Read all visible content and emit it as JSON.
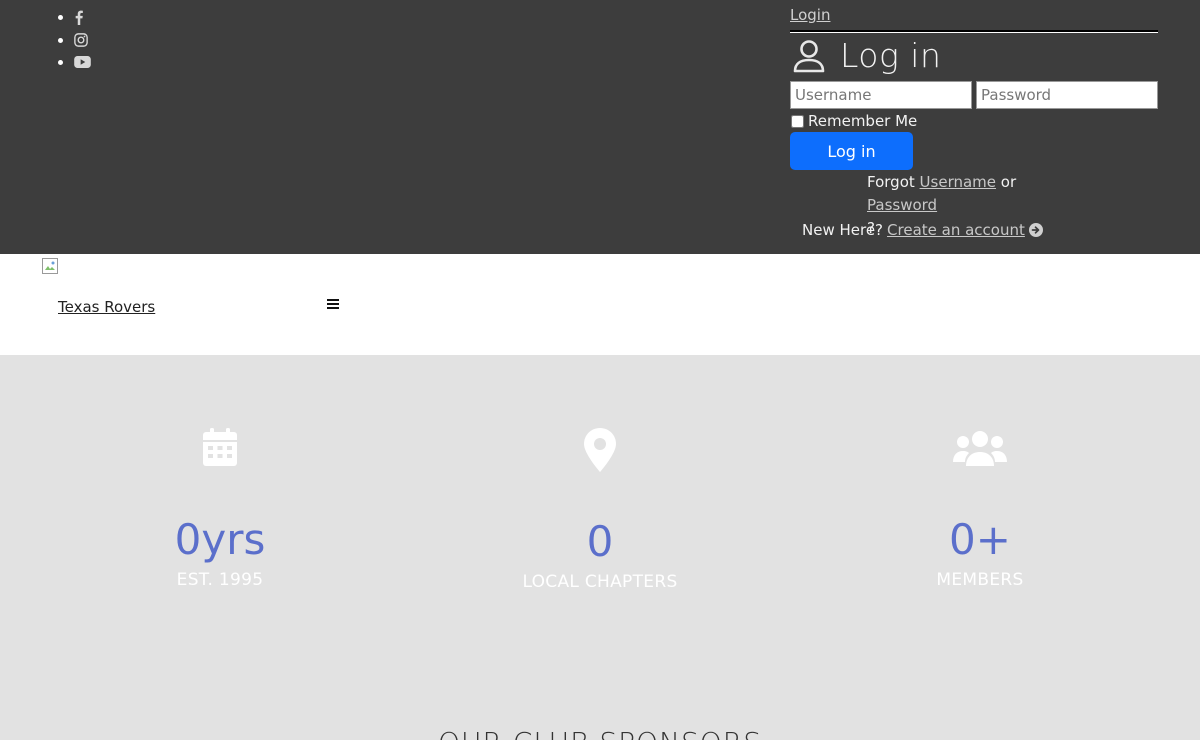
{
  "header": {
    "social": [
      {
        "icon": "facebook-icon"
      },
      {
        "icon": "instagram-icon"
      },
      {
        "icon": "youtube-icon"
      }
    ],
    "login_link": "Login",
    "login_title": "Log in",
    "username_placeholder": "Username",
    "password_placeholder": "Password",
    "remember_label": "Remember Me",
    "login_button": "Log in",
    "forgot_prefix": "Forgot",
    "forgot_username": "Username",
    "forgot_or": "or",
    "forgot_password": "Password",
    "forgot_suffix": "?",
    "new_here": "New Here?",
    "create_account": "Create an account"
  },
  "nav": {
    "brand": "Texas Rovers"
  },
  "stats": [
    {
      "icon": "calendar-icon",
      "value": "0yrs",
      "label": "EST. 1995"
    },
    {
      "icon": "map-pin-icon",
      "value": "0",
      "label": "LOCAL CHAPTERS"
    },
    {
      "icon": "users-icon",
      "value": "0+",
      "label": "MEMBERS"
    }
  ],
  "sponsors_heading": "OUR CLUB SPONSORS",
  "colors": {
    "topbar": "#3d3d3d",
    "accent_button": "#0d6efd",
    "stat_number": "#5b6fcb",
    "stats_bg": "#e2e2e2"
  }
}
